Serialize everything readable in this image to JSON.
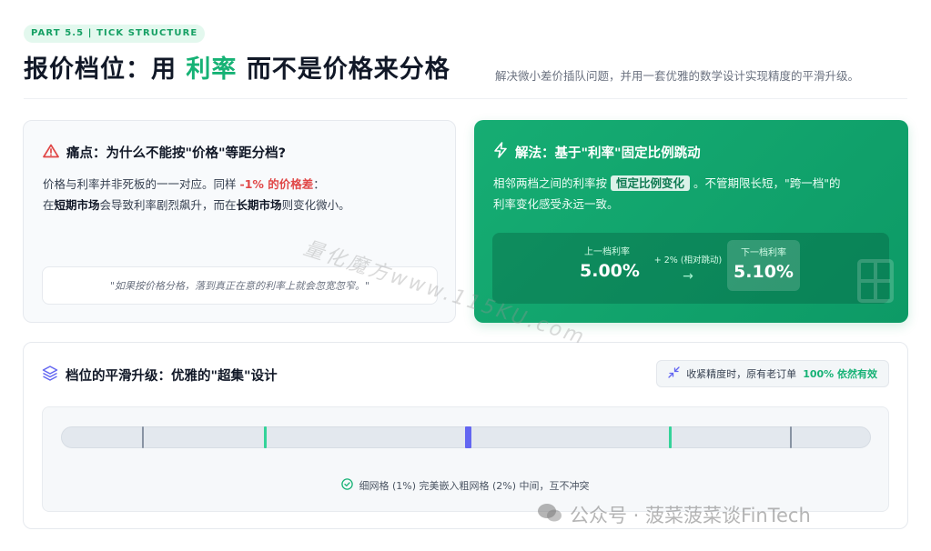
{
  "header": {
    "part_badge": "PART 5.5 | TICK STRUCTURE",
    "title_prefix": "报价档位：用",
    "title_accent": "利率",
    "title_suffix": "而不是价格来分格",
    "subtitle": "解决微小差价插队问题，并用一套优雅的数学设计实现精度的平滑升级。"
  },
  "pain_card": {
    "title": "痛点：为什么不能按\"价格\"等距分档?",
    "line1_prefix": "价格与利率并非死板的一一对应。同样",
    "line1_red": "-1% 的价格差",
    "line1_suffix": "：",
    "line2_prefix": "在",
    "line2_bold1": "短期市场",
    "line2_mid": "会导致利率剧烈飙升，而在",
    "line2_bold2": "长期市场",
    "line2_suffix": "则变化微小。",
    "quote": "\"如果按价格分格，落到真正在意的利率上就会忽宽忽窄。\""
  },
  "solution_card": {
    "title": "解法：基于\"利率\"固定比例跳动",
    "line1_prefix": "相邻两档之间的利率按",
    "line1_highlight": "恒定比例变化",
    "line1_suffix": "。不管期限长短，\"跨一档\"的",
    "line2": "利率变化感受永远一致。",
    "from_label": "上一档利率",
    "from_value": "5.00%",
    "jump_label": "+ 2% (相对跳动)",
    "to_label": "下一档利率",
    "to_value": "5.10%"
  },
  "bottom": {
    "title": "档位的平滑升级：优雅的\"超集\"设计",
    "compat_prefix": "收紧精度时，原有老订单",
    "compat_highlight": "100% 依然有效",
    "caption": "细网格 (1%) 完美嵌入粗网格 (2%) 中间，互不冲突"
  },
  "watermarks": {
    "mid": "量化魔方www.115KU.com",
    "bottom": "公众号 · 菠菜菠菜谈FinTech"
  },
  "colors": {
    "accent_green": "#16b275",
    "danger_red": "#e04747",
    "fine_tick": "#34d399",
    "center_tick": "#6366f1",
    "coarse_tick": "#8893a3"
  }
}
